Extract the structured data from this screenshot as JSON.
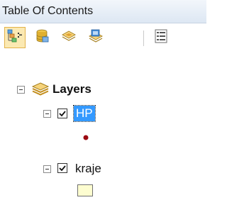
{
  "panel": {
    "title": "Table Of Contents"
  },
  "toolbar": {
    "buttons": [
      {
        "name": "list-by-drawing-order",
        "icon": "drawing-order-icon",
        "active": true
      },
      {
        "name": "list-by-source",
        "icon": "database-icon",
        "active": false
      },
      {
        "name": "list-by-visibility",
        "icon": "layers-visibility-icon",
        "active": false
      },
      {
        "name": "list-by-selection",
        "icon": "selection-icon",
        "active": false
      },
      {
        "name": "options",
        "icon": "options-icon",
        "active": false
      }
    ]
  },
  "tree": {
    "root": {
      "label": "Layers",
      "icon": "layers-icon",
      "expanded": true
    },
    "layers": [
      {
        "label": "HP",
        "checked": true,
        "selected": true,
        "expanded": true,
        "symbol": "point",
        "symbol_color": "#9b0a12"
      },
      {
        "label": "kraje",
        "checked": true,
        "selected": false,
        "expanded": true,
        "symbol": "polygon",
        "symbol_fill": "#fdfdd0",
        "symbol_outline": "#707070"
      }
    ]
  },
  "colors": {
    "title_bar": "#dde7f3",
    "selection": "#3399ff"
  }
}
